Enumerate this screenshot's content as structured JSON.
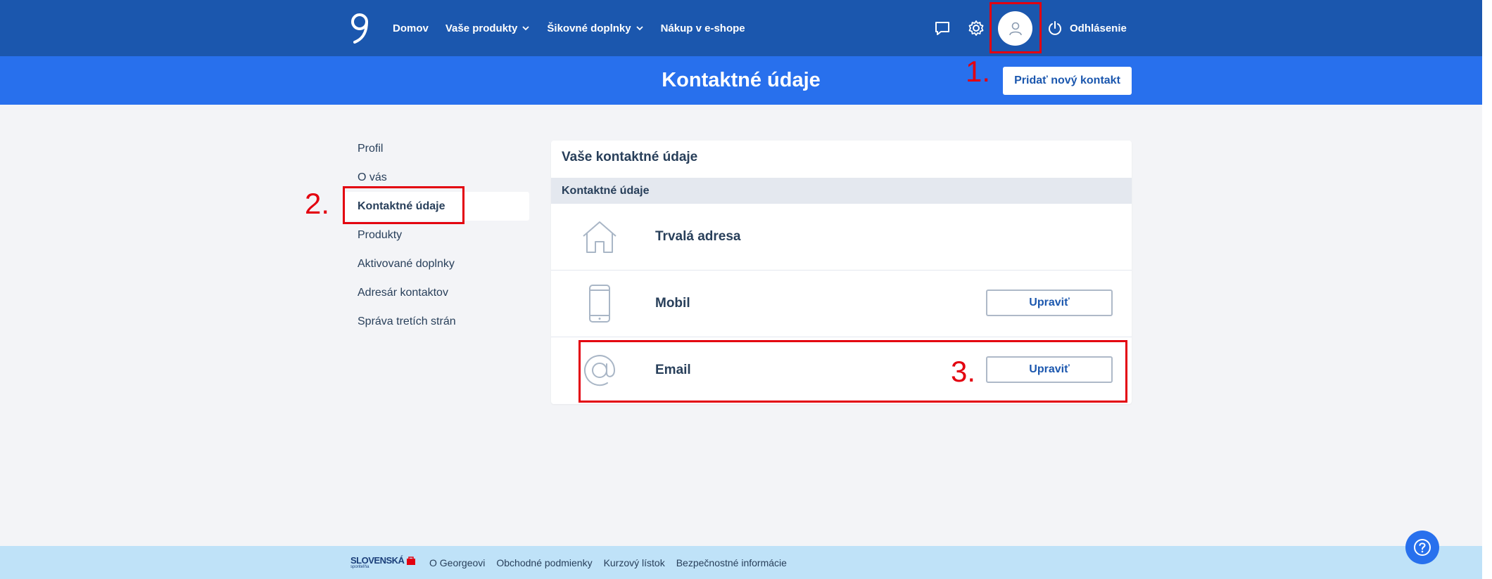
{
  "nav": {
    "links": [
      {
        "label": "Domov"
      },
      {
        "label": "Vaše produkty"
      },
      {
        "label": "Šikovné doplnky"
      },
      {
        "label": "Nákup v e-shope"
      }
    ],
    "logout_label": "Odhlásenie",
    "icons": [
      "logo-icon",
      "chat-icon",
      "gear-icon",
      "user-icon",
      "power-icon"
    ]
  },
  "header": {
    "title": "Kontaktné údaje",
    "add_contact_label": "Pridať nový kontakt"
  },
  "sidebar": {
    "items": [
      {
        "label": "Profil"
      },
      {
        "label": "O vás"
      },
      {
        "label": "Kontaktné údaje",
        "active": true
      },
      {
        "label": "Produkty"
      },
      {
        "label": "Aktivované doplnky"
      },
      {
        "label": "Adresár kontaktov"
      },
      {
        "label": "Správa tretích strán"
      }
    ]
  },
  "card": {
    "title": "Vaše kontaktné údaje",
    "section_header": "Kontaktné údaje",
    "rows": [
      {
        "label": "Trvalá adresa",
        "icon": "house-icon"
      },
      {
        "label": "Mobil",
        "icon": "phone-icon",
        "button": "Upraviť"
      },
      {
        "label": "Email",
        "icon": "at-icon",
        "button": "Upraviť"
      }
    ]
  },
  "annotations": {
    "a1": "1.",
    "a2": "2.",
    "a3": "3."
  },
  "footer": {
    "brand": "SLOVENSKÁ",
    "brand_sub": "sporiteľňa",
    "links": [
      {
        "label": "O Georgeovi"
      },
      {
        "label": "Obchodné podmienky"
      },
      {
        "label": "Kurzový lístok"
      },
      {
        "label": "Bezpečnostné informácie"
      }
    ]
  },
  "colors": {
    "nav_bg": "#1b57ae",
    "title_band": "#2870ed",
    "annotation_red": "#e3000f",
    "footer_bg": "#bfe2f8"
  }
}
